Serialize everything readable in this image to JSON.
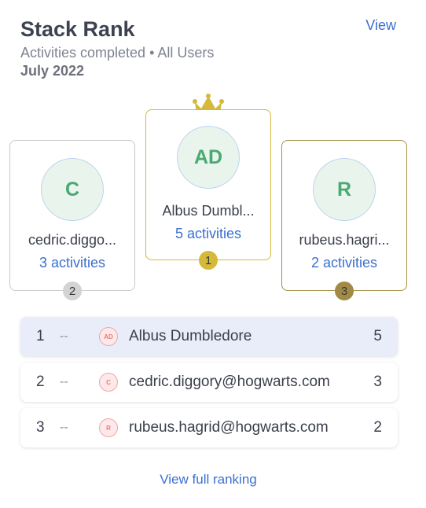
{
  "header": {
    "title": "Stack Rank",
    "view_label": "View",
    "subtitle": "Activities completed • All Users",
    "period": "July 2022"
  },
  "podium": {
    "first": {
      "initials": "AD",
      "name": "Albus Dumbl...",
      "activities": "5 activities",
      "rank": "1"
    },
    "second": {
      "initials": "C",
      "name": "cedric.diggo...",
      "activities": "3 activities",
      "rank": "2"
    },
    "third": {
      "initials": "R",
      "name": "rubeus.hagri...",
      "activities": "2 activities",
      "rank": "3"
    }
  },
  "ranking": [
    {
      "rank": "1",
      "change": "--",
      "initials": "AD",
      "name": "Albus Dumbledore",
      "count": "5"
    },
    {
      "rank": "2",
      "change": "--",
      "initials": "C",
      "name": "cedric.diggory@hogwarts.com",
      "count": "3"
    },
    {
      "rank": "3",
      "change": "--",
      "initials": "R",
      "name": "rubeus.hagrid@hogwarts.com",
      "count": "2"
    }
  ],
  "footer": {
    "full_ranking_label": "View full ranking"
  },
  "colors": {
    "accent": "#3b6fd0",
    "gold": "#d4b93a",
    "silver": "#d3d3d3",
    "bronze": "#a18a45",
    "highlight_row": "#e8edf9"
  },
  "icons": {
    "crown": "crown-icon"
  }
}
